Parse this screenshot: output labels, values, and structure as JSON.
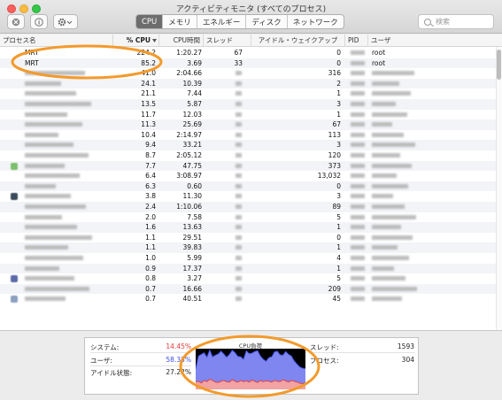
{
  "window": {
    "title": "アクティビティモニタ (すべてのプロセス)"
  },
  "toolbar": {
    "tabs": [
      "CPU",
      "メモリ",
      "エネルギー",
      "ディスク",
      "ネットワーク"
    ],
    "active_tab": "CPU",
    "search_placeholder": "検索"
  },
  "columns": {
    "name": "プロセス名",
    "cpu": "% CPU",
    "cputime": "CPU時間",
    "threads": "スレッド",
    "idle": "アイドル・ウェイクアップ",
    "pid": "PID",
    "user": "ユーザ"
  },
  "rows": [
    {
      "name": "MRT",
      "cpu": "224.2",
      "time": "1:20.27",
      "thr": "67",
      "idle": "0",
      "pid": "",
      "user": "root"
    },
    {
      "name": "MRT",
      "cpu": "85.2",
      "time": "3.69",
      "thr": "33",
      "idle": "0",
      "pid": "",
      "user": "root"
    },
    {
      "name": "",
      "cpu": "41.0",
      "time": "2:04.66",
      "thr": "",
      "idle": "316",
      "pid": "",
      "user": ""
    },
    {
      "name": "",
      "cpu": "24.1",
      "time": "10.39",
      "thr": "",
      "idle": "2",
      "pid": "",
      "user": ""
    },
    {
      "name": "",
      "cpu": "21.1",
      "time": "7.44",
      "thr": "",
      "idle": "1",
      "pid": "",
      "user": ""
    },
    {
      "name": "",
      "cpu": "13.5",
      "time": "5.87",
      "thr": "",
      "idle": "3",
      "pid": "",
      "user": ""
    },
    {
      "name": "",
      "cpu": "11.7",
      "time": "12.03",
      "thr": "",
      "idle": "1",
      "pid": "",
      "user": ""
    },
    {
      "name": "",
      "cpu": "11.3",
      "time": "25.69",
      "thr": "",
      "idle": "67",
      "pid": "",
      "user": ""
    },
    {
      "name": "",
      "cpu": "10.4",
      "time": "2:14.97",
      "thr": "",
      "idle": "113",
      "pid": "",
      "user": ""
    },
    {
      "name": "",
      "cpu": "9.4",
      "time": "33.21",
      "thr": "",
      "idle": "3",
      "pid": "",
      "user": ""
    },
    {
      "name": "",
      "cpu": "8.7",
      "time": "2:05.12",
      "thr": "",
      "idle": "120",
      "pid": "",
      "user": ""
    },
    {
      "name": "",
      "cpu": "7.7",
      "time": "47.75",
      "thr": "",
      "idle": "373",
      "pid": "",
      "user": ""
    },
    {
      "name": "",
      "cpu": "6.4",
      "time": "3:08.97",
      "thr": "",
      "idle": "13,032",
      "pid": "",
      "user": ""
    },
    {
      "name": "",
      "cpu": "6.3",
      "time": "0.60",
      "thr": "",
      "idle": "0",
      "pid": "",
      "user": ""
    },
    {
      "name": "",
      "cpu": "3.8",
      "time": "11.30",
      "thr": "",
      "idle": "3",
      "pid": "",
      "user": ""
    },
    {
      "name": "",
      "cpu": "2.4",
      "time": "1:10.06",
      "thr": "",
      "idle": "89",
      "pid": "",
      "user": ""
    },
    {
      "name": "",
      "cpu": "2.0",
      "time": "7.58",
      "thr": "",
      "idle": "5",
      "pid": "",
      "user": ""
    },
    {
      "name": "",
      "cpu": "1.6",
      "time": "13.63",
      "thr": "",
      "idle": "1",
      "pid": "",
      "user": ""
    },
    {
      "name": "",
      "cpu": "1.1",
      "time": "29.51",
      "thr": "",
      "idle": "0",
      "pid": "",
      "user": ""
    },
    {
      "name": "",
      "cpu": "1.1",
      "time": "39.83",
      "thr": "",
      "idle": "1",
      "pid": "",
      "user": ""
    },
    {
      "name": "",
      "cpu": "1.0",
      "time": "5.99",
      "thr": "",
      "idle": "4",
      "pid": "",
      "user": ""
    },
    {
      "name": "",
      "cpu": "0.9",
      "time": "17.37",
      "thr": "",
      "idle": "1",
      "pid": "",
      "user": ""
    },
    {
      "name": "",
      "cpu": "0.8",
      "time": "3.27",
      "thr": "",
      "idle": "5",
      "pid": "",
      "user": ""
    },
    {
      "name": "",
      "cpu": "0.7",
      "time": "16.66",
      "thr": "",
      "idle": "209",
      "pid": "",
      "user": ""
    },
    {
      "name": "",
      "cpu": "0.7",
      "time": "40.51",
      "thr": "",
      "idle": "45",
      "pid": "",
      "user": ""
    }
  ],
  "summary": {
    "system_label": "システム:",
    "system_value": "14.45%",
    "user_label": "ユーザ:",
    "user_value": "58.33%",
    "idle_label": "アイドル状態:",
    "idle_value": "27.22%",
    "graph_title": "CPU負荷",
    "threads_label": "スレッド:",
    "threads_value": "1593",
    "processes_label": "プロセス:",
    "processes_value": "304"
  },
  "colors": {
    "system": "#e23b3b",
    "user": "#3b4fe2",
    "annotation": "#f39a2b",
    "active_tab": "#6d6d6d"
  },
  "chart_data": {
    "type": "area",
    "title": "CPU負荷",
    "ylim": [
      0,
      100
    ],
    "series": [
      {
        "name": "システム",
        "values": [
          18,
          20,
          16,
          22,
          19,
          25,
          22,
          18,
          17,
          20,
          22,
          19,
          18,
          24,
          20,
          18,
          22,
          19,
          21,
          18,
          23,
          20,
          17,
          22,
          19,
          21,
          20,
          18,
          22,
          20,
          19,
          24,
          21,
          18,
          22,
          20,
          18,
          15,
          14,
          15
        ]
      },
      {
        "name": "ユーザ",
        "values": [
          32,
          62,
          70,
          68,
          60,
          72,
          58,
          66,
          70,
          74,
          65,
          60,
          68,
          72,
          70,
          63,
          58,
          55,
          74,
          70,
          66,
          73,
          78,
          60,
          55,
          48,
          58,
          62,
          70,
          74,
          66,
          60,
          72,
          68,
          60,
          50,
          44,
          40,
          38,
          36
        ]
      }
    ]
  }
}
